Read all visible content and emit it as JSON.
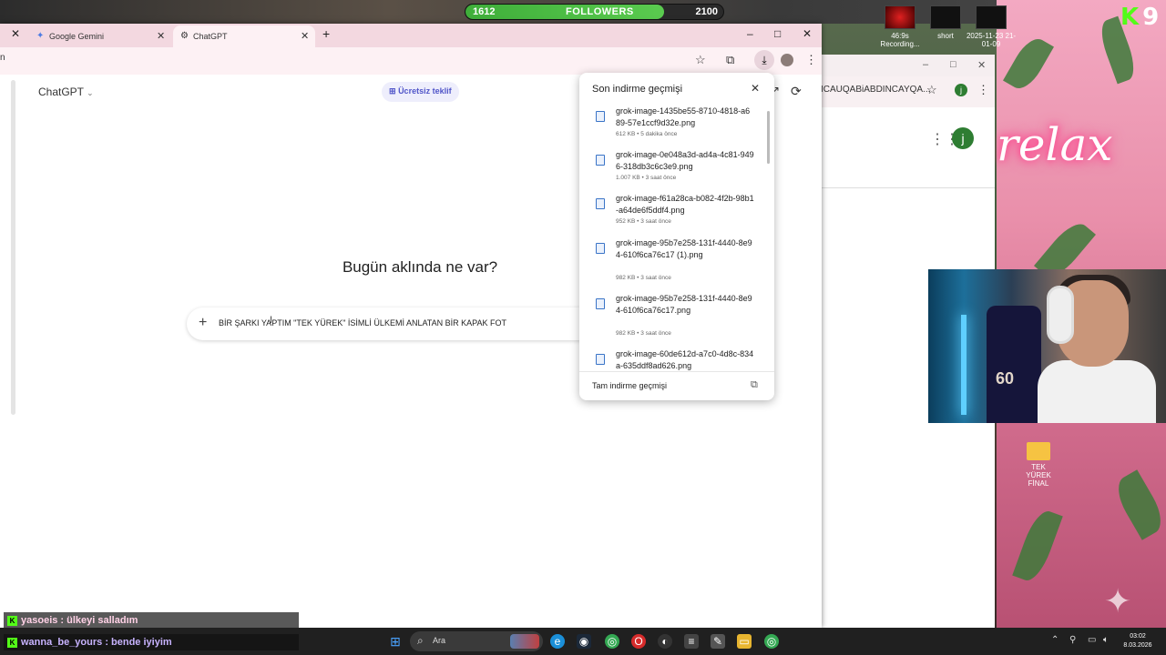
{
  "overlay": {
    "followers_current": "1612",
    "followers_label": "FOLLOWERS",
    "followers_goal": "2100",
    "followers_fraction": 0.77,
    "brand_badge": "K",
    "brand_number": "9",
    "neon_text": "relax"
  },
  "desktop_icons": [
    {
      "label": "46:9s Recording..."
    },
    {
      "label": "short"
    },
    {
      "label": "2025-11-23 21-01-09"
    }
  ],
  "desktop_folder": {
    "label": "TEK YÜREK FİNAL"
  },
  "tabs": [
    {
      "label": "Google Gemini",
      "icon": "gemini-icon"
    },
    {
      "label": "ChatGPT",
      "icon": "openai-icon"
    }
  ],
  "chatgpt": {
    "model_selector": "ChatGPT",
    "offer_badge": "Ücretsiz teklif",
    "headline": "Bugün aklında ne var?",
    "prompt_text": "BİR ŞARKI YAPTIM \"TEK YÜREK\" İSİMLİ ÜLKEMİ ANLATAN BİR KAPAK FOT"
  },
  "downloads": {
    "title": "Son indirme geçmişi",
    "footer": "Tam indirme geçmişi",
    "items": [
      {
        "name": "grok-image-1435be55-8710-4818-a689-57e1ccf9d32e.png",
        "meta": "612 KB • 5 dakika önce"
      },
      {
        "name": "grok-image-0e048a3d-ad4a-4c81-9496-318db3c6c3e9.png",
        "meta": "1.007 KB • 3 saat önce"
      },
      {
        "name": "grok-image-f61a28ca-b082-4f2b-98b1-a64de6f5ddf4.png",
        "meta": "952 KB • 3 saat önce"
      },
      {
        "name": "grok-image-95b7e258-131f-4440-8e94-610f6ca76c17 (1).png",
        "meta": "982 KB • 3 saat önce"
      },
      {
        "name": "grok-image-95b7e258-131f-4440-8e94-610f6ca76c17.png",
        "meta": "982 KB • 3 saat önce"
      },
      {
        "name": "grok-image-60de612d-a7c0-4d8c-834a-635ddf8ad626.png",
        "meta": ""
      }
    ]
  },
  "bg_window": {
    "url_fragment": "ICAUQABiABDINCAYQA...",
    "avatar_letter": "j"
  },
  "chat": [
    {
      "user": "yasoeis",
      "message": "ülkeyi salladım",
      "line": "yasoeis : ülkeyi salladım"
    },
    {
      "user": "wanna_be_yours",
      "message": "bende iyiyim",
      "line": "wanna_be_yours : bende iyiyim"
    }
  ],
  "taskbar": {
    "search_placeholder": "Ara",
    "time": "03:02",
    "date": "8.03.2026"
  }
}
